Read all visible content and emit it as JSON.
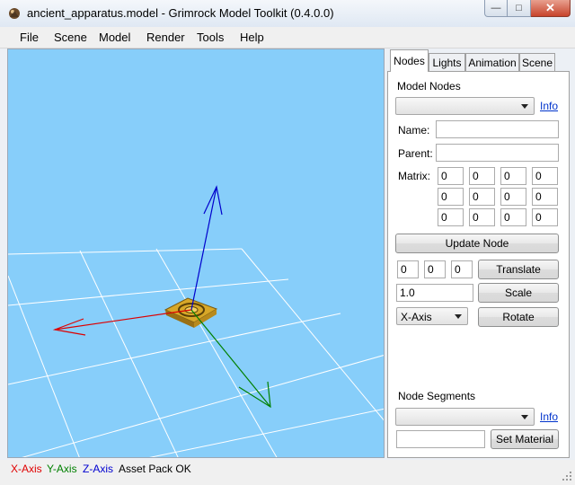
{
  "window": {
    "title": "ancient_apparatus.model - Grimrock Model Toolkit (0.4.0.0)"
  },
  "menu": [
    "File",
    "Scene",
    "Model",
    "Render",
    "Tools",
    "Help"
  ],
  "tabs": [
    "Nodes",
    "Lights",
    "Animation",
    "Scene"
  ],
  "active_tab": "Nodes",
  "nodes_panel": {
    "model_nodes_label": "Model Nodes",
    "info_link": "Info",
    "model_nodes_value": "",
    "name_label": "Name:",
    "name_value": "",
    "parent_label": "Parent:",
    "parent_value": "",
    "matrix_label": "Matrix:",
    "matrix": [
      [
        "0",
        "0",
        "0",
        "0"
      ],
      [
        "0",
        "0",
        "0",
        "0"
      ],
      [
        "0",
        "0",
        "0",
        "0"
      ]
    ],
    "update_node_button": "Update Node",
    "translate": [
      "0",
      "0",
      "0"
    ],
    "translate_button": "Translate",
    "scale_value": "1.0",
    "scale_button": "Scale",
    "axis_select": "X-Axis",
    "rotate_button": "Rotate",
    "node_segments_label": "Node Segments",
    "segments_info_link": "Info",
    "segments_value": "",
    "material_value": "",
    "set_material_button": "Set Material"
  },
  "status": {
    "x_axis": "X-Axis",
    "y_axis": "Y-Axis",
    "z_axis": "Z-Axis",
    "asset": "Asset Pack OK",
    "colors": {
      "x": "#e00000",
      "y": "#008000",
      "z": "#0000d0"
    }
  },
  "viewport": {
    "background": "#87cefa",
    "icons": [
      "model-icon",
      "axis-gizmo"
    ]
  }
}
